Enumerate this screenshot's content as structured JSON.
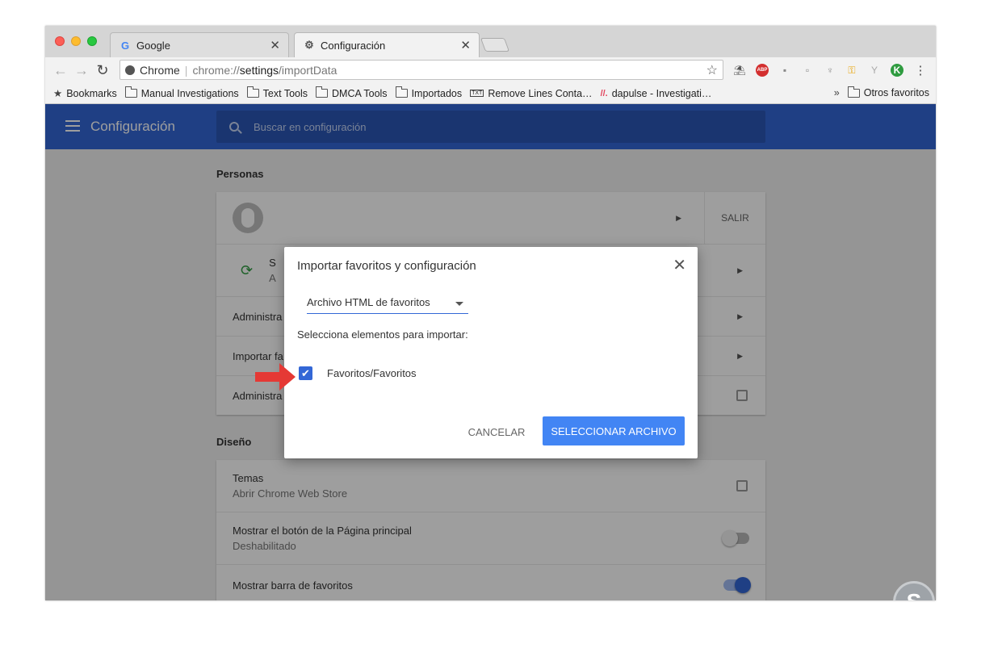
{
  "browser": {
    "tabs": [
      {
        "label": "Google",
        "favicon": "google-icon"
      },
      {
        "label": "Configuración",
        "favicon": "gear-icon"
      }
    ],
    "omnibox": {
      "site_label": "Chrome",
      "url_scheme": "chrome://",
      "url_host": "settings",
      "url_path": "/importData"
    },
    "bookmarks": [
      {
        "label": "Bookmarks",
        "icon": "star-icon"
      },
      {
        "label": "Manual Investigations",
        "icon": "folder-icon"
      },
      {
        "label": "Text Tools",
        "icon": "folder-icon"
      },
      {
        "label": "DMCA Tools",
        "icon": "folder-icon"
      },
      {
        "label": "Importados",
        "icon": "folder-icon"
      },
      {
        "label": "Remove Lines Conta…",
        "icon": "txt-icon"
      },
      {
        "label": "dapulse - Investigati…",
        "icon": "dapulse-icon"
      }
    ],
    "bookmarks_overflow": "»",
    "other_bookmarks": "Otros favoritos"
  },
  "settings": {
    "header_title": "Configuración",
    "search_placeholder": "Buscar en configuración",
    "personas_title": "Personas",
    "salir_label": "SALIR",
    "sync_row_initial": "S",
    "sync_row_sub_initial": "A",
    "row_admin_partial": "Administra",
    "row_import_partial": "Importar fa",
    "row_admin2_partial": "Administra",
    "diseno_title": "Diseño",
    "temas_label": "Temas",
    "temas_sub": "Abrir Chrome Web Store",
    "home_button_label": "Mostrar el botón de la Página principal",
    "home_button_sub": "Deshabilitado",
    "bookmarks_bar_label": "Mostrar barra de favoritos"
  },
  "dialog": {
    "title": "Importar favoritos y configuración",
    "source_selected": "Archivo HTML de favoritos",
    "select_label": "Selecciona elementos para importar:",
    "checkbox_label": "Favoritos/Favoritos",
    "checkbox_checked": true,
    "cancel_label": "CANCELAR",
    "primary_label": "SELECCIONAR ARCHIVO"
  },
  "colors": {
    "accent": "#3367d6",
    "primary_button": "#4285f4",
    "annotation_arrow": "#e53935"
  },
  "watermark_letter": "S"
}
